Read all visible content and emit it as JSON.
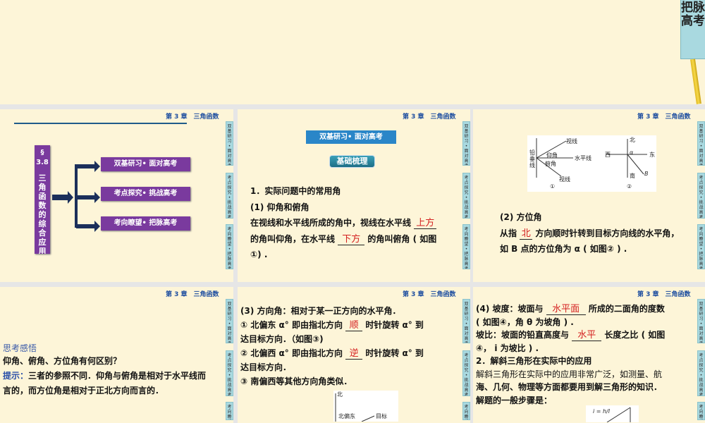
{
  "top_tab": "把脉高考",
  "header": "第 3 章　三角函数",
  "side_tabs": [
    "双基研习•面对高考",
    "考点探究•挑战高考",
    "考向瞭望•把脉高考"
  ],
  "slide1": {
    "section_num": "§ 3.8",
    "section_title": "三角函数的综合应用",
    "buttons": [
      "双基研习• 面对高考",
      "考点探究• 挑战高考",
      "考向瞭望• 把脉高考"
    ]
  },
  "slide2": {
    "banner": "双基研习• 面对高考",
    "badge": "基础梳理",
    "l1": "1．实际问题中的常用角",
    "l2": "(1) 仰角和俯角",
    "l3a": "在视线和水平线所成的角中，视线在水平线",
    "b1": "上方",
    "l4a": "的角叫仰角，在水平线",
    "b2": "下方",
    "l4b": "的角叫俯角 ( 如图",
    "l5": "①) ."
  },
  "slide3": {
    "fig1": {
      "a": "视线",
      "b": "铅垂线",
      "c": "仰角",
      "d": "水平线",
      "e": "俯角",
      "f": "视线",
      "cap": "①"
    },
    "fig2": {
      "n": "北",
      "w": "西",
      "e": "东",
      "s": "南",
      "alpha": "α",
      "b": "B",
      "cap": "②"
    },
    "l1": "(2) 方位角",
    "l2a": "从指",
    "b1": "北",
    "l2b": "方向顺时针转到目标方向线的水平角，",
    "l3": "如 B 点的方位角为 α ( 如图② ) ."
  },
  "slide4": {
    "title": "思考感悟",
    "q": "仰角、俯角、方位角有何区别？",
    "hint_label": "提示：",
    "hint": "三者的参照不同．仰角与俯角是相对于水平线而言的，而方位角是相对于正北方向而言的．"
  },
  "slide5": {
    "l1": "(3) 方向角：相对于某一正方向的水平角．",
    "l2a": "① 北偏东 α° 即由指北方向",
    "b1": "顺",
    "l2b": "时针旋转 α° 到",
    "l3": "达目标方向．（如图③)",
    "l4a": "② 北偏西 α° 即由指北方向",
    "b2": "逆",
    "l4b": "时针旋转 α° 到",
    "l5": "达目标方向．",
    "l6": "③ 南偏西等其他方向角类似．",
    "fig": {
      "n": "北",
      "ne": "北偏东",
      "t": "目标"
    }
  },
  "slide6": {
    "l1a": "(4) 坡度：坡面与",
    "b1": "水平面",
    "l1b": "所成的二面角的度数",
    "l2": "( 如图④，角 θ 为坡角 ) .",
    "l3a": "坡比：坡面的铅直高度与",
    "b2": "水平",
    "l3b": "长度之比 ( 如图",
    "l4": "④， i 为坡比 ) .",
    "l5": "2．解斜三角形在实际中的应用",
    "l6": "解斜三角形在实际中的应用非常广泛，如测量、航",
    "l7": "海、几何、物理等方面都要用到解三角形的知识．",
    "l8": "解题的一般步骤是：",
    "fig": {
      "i": "i = h/l"
    }
  }
}
